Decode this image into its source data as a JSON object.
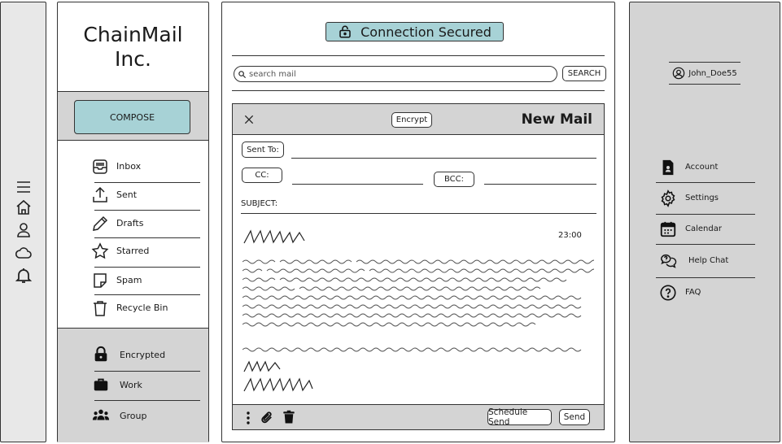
{
  "brand": {
    "line1": "ChainMail",
    "line2": "Inc."
  },
  "compose_label": "COMPOSE",
  "folders": [
    {
      "label": "Inbox",
      "icon": "inbox-icon"
    },
    {
      "label": "Sent",
      "icon": "upload-icon"
    },
    {
      "label": "Drafts",
      "icon": "pencil-icon"
    },
    {
      "label": "Starred",
      "icon": "star-icon"
    },
    {
      "label": "Spam",
      "icon": "note-icon"
    },
    {
      "label": "Recycle Bin",
      "icon": "trash-icon"
    }
  ],
  "labels": [
    {
      "label": "Encrypted",
      "icon": "lock-icon"
    },
    {
      "label": "Work",
      "icon": "briefcase-icon"
    },
    {
      "label": "Group",
      "icon": "people-icon"
    }
  ],
  "rail_icons": [
    "menu-icon",
    "home-icon",
    "user-icon",
    "cloud-icon",
    "bell-icon"
  ],
  "status": {
    "text": "Connection Secured",
    "color": "#a7d2d6"
  },
  "search": {
    "placeholder": "search mail",
    "button": "SEARCH"
  },
  "mail": {
    "title": "New Mail",
    "encrypt_label": "Encrypt",
    "to_label": "Sent To:",
    "cc_label": "CC:",
    "bcc_label": "BCC:",
    "subject_label": "SUBJECT:",
    "time": "23:00",
    "schedule_label": "Schedule Send",
    "send_label": "Send"
  },
  "user": {
    "name": "John_Doe55"
  },
  "settings": [
    {
      "label": "Account",
      "icon": "account-file-icon"
    },
    {
      "label": "Settings",
      "icon": "gear-icon"
    },
    {
      "label": "Calendar",
      "icon": "calendar-icon"
    },
    {
      "label": "Help Chat",
      "icon": "chat-icon"
    },
    {
      "label": "FAQ",
      "icon": "question-icon"
    }
  ],
  "colors": {
    "accent": "#a7d2d6",
    "panel_gray": "#d4d4d4",
    "rail_gray": "#e8e8e8"
  }
}
